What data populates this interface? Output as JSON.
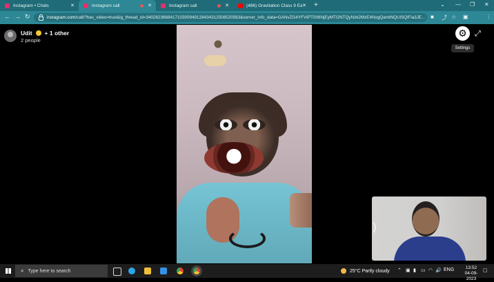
{
  "browser": {
    "tabs": [
      {
        "title": "Instagram • Chats",
        "favicon_color": "#e1306c",
        "active": false
      },
      {
        "title": "Instagram call",
        "favicon_color": "#e1306c",
        "active": true
      },
      {
        "title": "Instagram call",
        "favicon_color": "#e1306c",
        "active": false
      },
      {
        "title": "(486) Gravitation Class 9 Easiest",
        "favicon_color": "#ff0000",
        "active": false
      }
    ],
    "new_tab_icon": "+",
    "window_controls": {
      "minimize": "—",
      "restore": "❐",
      "close": "✕"
    },
    "address": {
      "host": "instagram.com",
      "path": "/call/?has_video=true&ig_thread_id=340282366841710300949128434312508520563&server_info_data=GANvZG4YFVIPT006NjEyMTI2NTQyNzk2MzE4NxgQamtNQUlSQlFia3JE..."
    },
    "profile_letter": "U"
  },
  "call": {
    "name": "Udit",
    "others": "+ 1 other",
    "count": "2 people",
    "settings_tooltip": "Settings"
  },
  "taskbar": {
    "search_placeholder": "Type here to search",
    "weather": "25°C  Partly cloudy",
    "lang": "ENG",
    "time": "13:52",
    "date": "04-09-2023"
  }
}
